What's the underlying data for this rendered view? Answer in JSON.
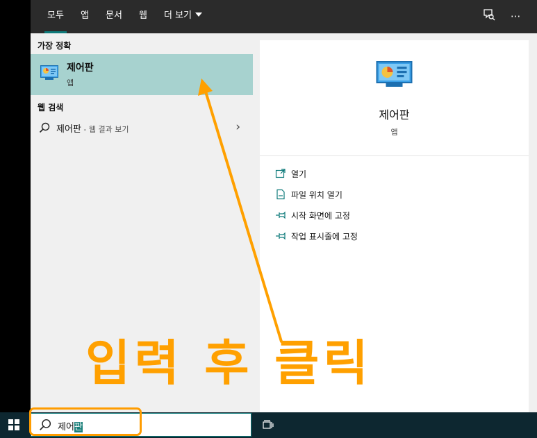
{
  "tabs": [
    {
      "label": "모두"
    },
    {
      "label": "앱"
    },
    {
      "label": "문서"
    },
    {
      "label": "웹"
    },
    {
      "label": "더 보기"
    }
  ],
  "topbar": {
    "feedback_icon": "feedback-icon",
    "more_icon": "ellipsis-icon",
    "more_glyph": "···"
  },
  "results": {
    "best_match_heading": "가장 정확",
    "best_match": {
      "title": "제어판",
      "subtitle": "앱",
      "icon": "control-panel-icon"
    },
    "web_heading": "웹 검색",
    "web_item": {
      "query": "제어판",
      "suffix": " - 웹 결과 보기",
      "icon": "search-icon",
      "chevron": "›"
    }
  },
  "preview": {
    "title": "제어판",
    "subtitle": "앱",
    "actions": [
      {
        "label": "열기",
        "icon": "open-icon"
      },
      {
        "label": "파일 위치 열기",
        "icon": "file-location-icon"
      },
      {
        "label": "시작 화면에 고정",
        "icon": "pin-icon"
      },
      {
        "label": "작업 표시줄에 고정",
        "icon": "pin-icon"
      }
    ]
  },
  "taskbar": {
    "search_value_prefix": "제어",
    "search_value_selected": "판",
    "start_icon": "windows-logo-icon",
    "taskview_icon": "task-view-icon"
  },
  "annotation": {
    "text": "입력 후 클릭",
    "color": "#ffa000"
  },
  "colors": {
    "accent": "#0e7a7a",
    "selection": "#a7d2cf",
    "taskbar": "#0d2730",
    "annotation": "#ff9c00"
  }
}
